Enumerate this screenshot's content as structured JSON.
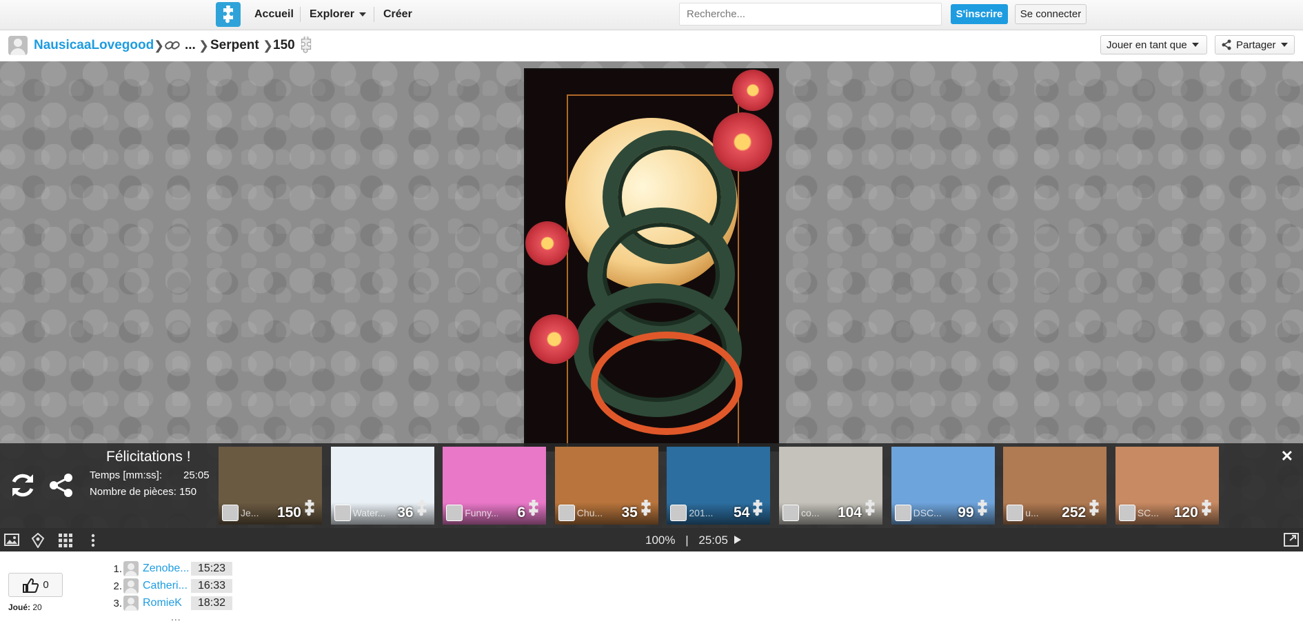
{
  "topnav": {
    "home": "Accueil",
    "explore": "Explorer",
    "create": "Créer",
    "search_placeholder": "Recherche...",
    "signup": "S'inscrire",
    "login": "Se connecter"
  },
  "breadcrumb": {
    "user": "NausicaaLovegood",
    "ellipsis": "...",
    "title": "Serpent",
    "pieces": "150",
    "play_as": "Jouer en tant que",
    "share": "Partager"
  },
  "congrats": {
    "title": "Félicitations !",
    "time_label": "Temps [mm:ss]:",
    "time_value": "25:05",
    "pieces_label": "Nombre de pièces: 150"
  },
  "thumbnails": [
    {
      "name": "Je...",
      "count": "150",
      "bg": "#6b5a42"
    },
    {
      "name": "Water...",
      "count": "36",
      "bg": "#eaf1f6"
    },
    {
      "name": "Funny...",
      "count": "6",
      "bg": "#e978c8"
    },
    {
      "name": "Chu...",
      "count": "35",
      "bg": "#b8743c"
    },
    {
      "name": "201...",
      "count": "54",
      "bg": "#2c6ea0"
    },
    {
      "name": "co...",
      "count": "104",
      "bg": "#c4c2ba"
    },
    {
      "name": "DSC...",
      "count": "99",
      "bg": "#6ea4dc"
    },
    {
      "name": "u...",
      "count": "252",
      "bg": "#b07a52"
    },
    {
      "name": "SC...",
      "count": "120",
      "bg": "#c88a62"
    }
  ],
  "toolbar": {
    "zoom": "100%",
    "separator": "|",
    "timer": "25:05"
  },
  "likes": {
    "count": "0",
    "played_label": "Joué:",
    "played_count": "20"
  },
  "leaderboard": [
    {
      "rank": "1.",
      "name": "Zenobe...",
      "time": "15:23"
    },
    {
      "rank": "2.",
      "name": "Catheri...",
      "time": "16:33"
    },
    {
      "rank": "3.",
      "name": "RomieK",
      "time": "18:32"
    }
  ],
  "leaderboard_more": "..."
}
